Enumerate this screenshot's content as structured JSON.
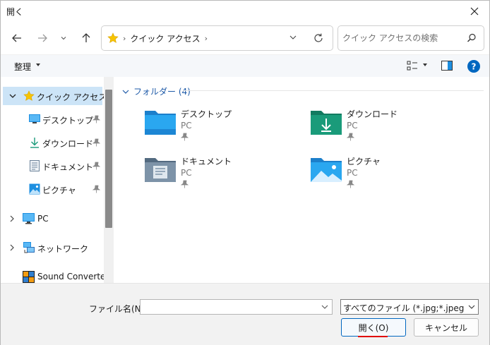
{
  "window": {
    "title": "開く"
  },
  "nav": {
    "address": "クイック アクセス",
    "search_placeholder": "クイック アクセスの検索"
  },
  "toolbar": {
    "organize_label": "整理"
  },
  "sidebar": {
    "quick_access": "クイック アクセス",
    "items": [
      {
        "label": "デスクトップ"
      },
      {
        "label": "ダウンロード"
      },
      {
        "label": "ドキュメント"
      },
      {
        "label": "ピクチャ"
      }
    ],
    "pc": "PC",
    "network": "ネットワーク",
    "sound_converter": "Sound Converter"
  },
  "content": {
    "group_title": "フォルダー (4)",
    "folders": [
      {
        "name": "デスクトップ",
        "location": "PC",
        "icon": "desktop-folder-icon"
      },
      {
        "name": "ダウンロード",
        "location": "PC",
        "icon": "downloads-folder-icon"
      },
      {
        "name": "ドキュメント",
        "location": "PC",
        "icon": "documents-folder-icon"
      },
      {
        "name": "ピクチャ",
        "location": "PC",
        "icon": "pictures-folder-icon"
      }
    ]
  },
  "bottom": {
    "filename_label": "ファイル名(N):",
    "filename_value": "",
    "filetype_value": "すべてのファイル (*.jpg;*.jpeg;*.thum",
    "open_label": "開く(O)",
    "cancel_label": "キャンセル"
  },
  "colors": {
    "accent": "#0067c0",
    "selection": "#cce4f7",
    "folder_blue": "#1e8fe0",
    "folder_teal": "#1a9b7a",
    "folder_gray": "#6b8299",
    "star": "#f7c400"
  }
}
